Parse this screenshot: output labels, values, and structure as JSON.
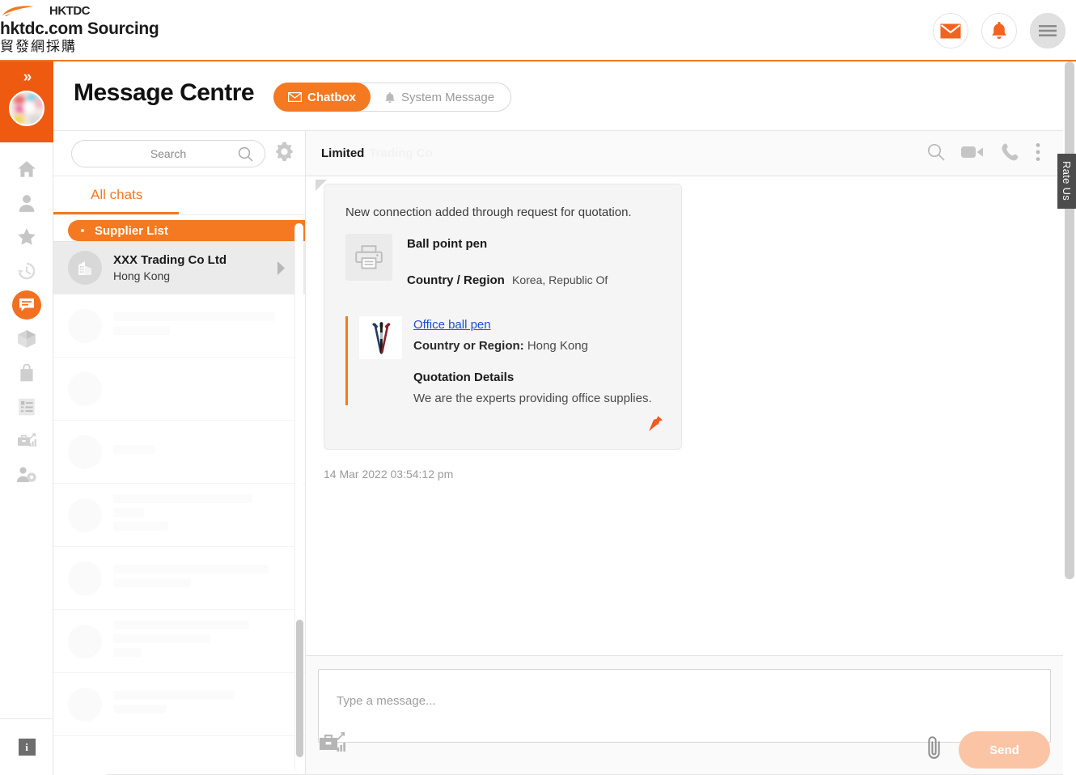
{
  "header": {
    "logo_word": "HKTDC",
    "brand_en": "hktdc.com Sourcing",
    "brand_zh": "貿發網採購",
    "icons": [
      {
        "name": "mail-icon",
        "label": "Messages"
      },
      {
        "name": "bell-icon",
        "label": "Notifications"
      },
      {
        "name": "hamburger-menu-icon",
        "label": "Menu"
      }
    ]
  },
  "rail": {
    "collapse_label": "»",
    "items": [
      {
        "name": "home-icon",
        "label": "Home"
      },
      {
        "name": "user-icon",
        "label": "Profile"
      },
      {
        "name": "star-icon",
        "label": "Favourites"
      },
      {
        "name": "history-icon",
        "label": "History"
      },
      {
        "name": "chat-icon",
        "label": "Messages"
      },
      {
        "name": "box-icon",
        "label": "Products"
      },
      {
        "name": "bag-icon",
        "label": "Orders"
      },
      {
        "name": "list-icon",
        "label": "Lists"
      },
      {
        "name": "briefcase-chart-icon",
        "label": "Business"
      },
      {
        "name": "user-settings-icon",
        "label": "Account Settings"
      }
    ],
    "info_label": "i"
  },
  "page": {
    "title": "Message Centre",
    "tabs": [
      {
        "label": "Chatbox",
        "icon": "mail-icon",
        "active": true
      },
      {
        "label": "System Message",
        "icon": "bell-icon",
        "active": false
      }
    ]
  },
  "chatlist": {
    "search": {
      "placeholder": "Search",
      "value": ""
    },
    "settings_icon": "gear-icon",
    "tabs": [
      {
        "label": "All chats",
        "active": true
      },
      {
        "label": "",
        "active": false
      }
    ],
    "group_header": "Supplier List",
    "items": [
      {
        "name": "XXX  Trading Co Ltd",
        "location": "Hong Kong",
        "selected": true
      }
    ]
  },
  "conversation": {
    "title": "Limited",
    "header_icons": [
      {
        "name": "search-icon",
        "label": "Search in conversation"
      },
      {
        "name": "video-camera-icon",
        "label": "Video call"
      },
      {
        "name": "phone-icon",
        "label": "Voice call"
      },
      {
        "name": "more-options-icon",
        "label": "More options"
      }
    ],
    "message": {
      "lead": "New connection added through request for quotation.",
      "product": {
        "thumb_icon": "printer-icon",
        "name": "Ball point pen",
        "country_label": "Country / Region",
        "country_value": "Korea, Republic Of"
      },
      "quotation": {
        "thumb_icon": "ball-pen-photo",
        "link_text": "Office ball pen",
        "country_label": "Country or Region:",
        "country_value": "Hong Kong",
        "details_heading": "Quotation Details",
        "details_body": "We are the experts providing office supplies.",
        "pin_icon": "pin-icon"
      },
      "timestamp": "14 Mar 2022 03:54:12 pm"
    }
  },
  "composer": {
    "placeholder": "Type a message...",
    "value": "",
    "biz_icon": "briefcase-chart-icon",
    "attach_icon": "paperclip-icon",
    "send_label": "Send"
  },
  "rate_us": {
    "label": "Rate Us"
  },
  "colors": {
    "brand_orange": "#f47920",
    "rail_orange": "#ee5a10",
    "link_blue": "#1a4fd6",
    "send_disabled": "#fbc4a5"
  }
}
